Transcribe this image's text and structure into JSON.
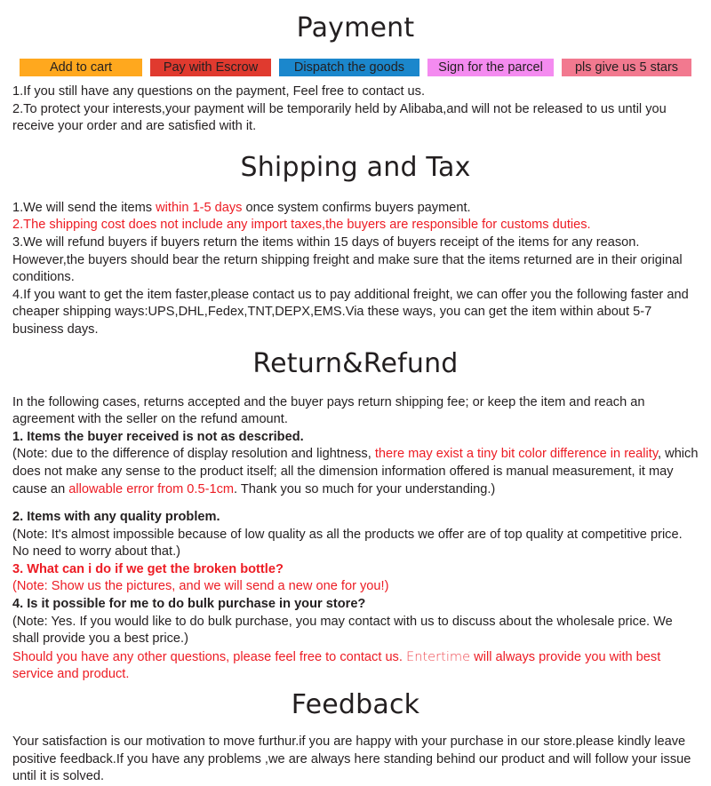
{
  "sections": {
    "payment": {
      "title": "Payment",
      "badges": [
        {
          "label": "Add to cart",
          "color": "#ffa81e"
        },
        {
          "label": "Pay with Escrow",
          "color": "#e03a2f"
        },
        {
          "label": "Dispatch the goods",
          "color": "#1b87cc"
        },
        {
          "label": "Sign for the parcel",
          "color": "#f48bf0"
        },
        {
          "label": "pls give us 5 stars",
          "color": "#f2798f"
        }
      ],
      "lines": [
        "1.If you still have any questions on the payment, Feel free to contact us.",
        "2.To protect your interests,your payment will be temporarily held by Alibaba,and will not be released to us until you receive your order and are satisfied with it."
      ]
    },
    "shipping": {
      "title": "Shipping and Tax",
      "line1_a": "1.We will send the items ",
      "line1_red": "within 1-5 days",
      "line1_b": " once system confirms buyers payment.",
      "line2_red": "2.The shipping cost does not include any import taxes,the buyers are responsible for customs duties.",
      "line3": "3.We will refund buyers if buyers return the items within 15 days of buyers receipt of the items for any reason. However,the buyers should bear the return shipping freight and make sure that the items returned are in their original conditions.",
      "line4": "4.If you want to get the item faster,please contact us to pay additional freight, we can offer you the following faster and cheaper shipping ways:UPS,DHL,Fedex,TNT,DEPX,EMS.Via these ways, you can get the item within about 5-7 business days."
    },
    "return_refund": {
      "title": "Return&Refund",
      "intro": "In the following cases, returns accepted and the buyer pays return shipping fee; or keep the item and reach an agreement with the seller on the refund amount.",
      "q1_heading": "1. Items the buyer received is not as described.",
      "q1_note_a": "(Note: due to the difference of display resolution and lightness, ",
      "q1_note_red1": "there may exist a tiny bit color difference in reality",
      "q1_note_b": ", which does not make any sense to the product itself; all the dimension information offered is manual measurement, it may cause an ",
      "q1_note_red2": "allowable error from 0.5-1cm",
      "q1_note_c": ". Thank you so much for your understanding.)",
      "q2_heading": "2. Items with any quality problem.",
      "q2_note": "(Note: It's almost impossible because of low quality as all the products we offer are of top quality at competitive price. No need to worry about that.)",
      "q3_heading": "3. What can i do if we get the broken bottle?",
      "q3_note": "(Note: Show us the pictures, and we will send a new one for you!)",
      "q4_heading": "4. Is it possible for me to do bulk purchase in your store?",
      "q4_note": "(Note: Yes. If you would like to do bulk purchase, you may contact with us to discuss about the wholesale price. We shall provide you a best price.)",
      "closing_a": "Should you have any other questions, please feel free to contact us. ",
      "closing_brand": "Entertime",
      "closing_b": " will always provide you with best service and product."
    },
    "feedback": {
      "title": "Feedback",
      "text": "Your satisfaction is our motivation to move furthur.if you are happy with your purchase in our store.please kindly leave positive feedback.If you have any problems ,we are always here standing behind our product and will follow your issue until it is solved."
    }
  },
  "theme": {
    "text_color": "#231f20",
    "accent_red": "#ed1c24",
    "background": "#ffffff"
  }
}
